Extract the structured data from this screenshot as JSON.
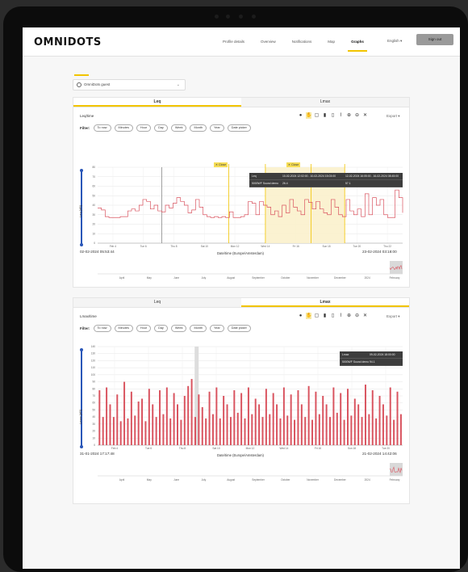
{
  "app": {
    "logo": "OMNIDOTS",
    "nav": [
      "Profile details",
      "Overview",
      "Notifications",
      "Map",
      "Graphs"
    ],
    "language": "English ▾",
    "sign_out": "Sign out"
  },
  "device_select": {
    "value": "OmniDots guest",
    "chevron": "⌄"
  },
  "panels": [
    {
      "tabs": [
        "Leq",
        "Lmax"
      ],
      "chart_title": "Leq/time",
      "filter_label": "Filter:",
      "filters": [
        "To now",
        "Minutes",
        "Hour",
        "Day",
        "Week",
        "Month",
        "Year",
        "Date picker"
      ],
      "export": "Export ▾",
      "y_label": "Leq [dB]",
      "x_label": "Date/time (Europe/Amsterdam)",
      "date_start": "02-02-2024 05:53:44",
      "date_end": "23-02-2024 03:18:00",
      "x_ticks": [
        "Feb 4",
        "Tue 6",
        "Thu 8",
        "Sat 10",
        "Mon 12",
        "Wed 14",
        "Fri 16",
        "Sun 18",
        "Tue 20",
        "Thu 22"
      ],
      "nav_ticks": [
        "April",
        "May",
        "June",
        "July",
        "August",
        "September",
        "October",
        "November",
        "December",
        "2024",
        "February"
      ],
      "close_label": "✕ Close",
      "legend": {
        "headers": [
          "Leq",
          "10-02-2024 12:02:00 - 10-02-2024 15:03:00",
          "12-02-2024 16:05:00 - 16-02-2024 08:45:00"
        ],
        "row": [
          "5000WF Sound demo",
          "26.4",
          "57.1"
        ]
      }
    },
    {
      "tabs": [
        "Leq",
        "Lmax"
      ],
      "chart_title": "Lmax/time",
      "filter_label": "Filter:",
      "filters": [
        "To now",
        "Minutes",
        "Hour",
        "Day",
        "Week",
        "Month",
        "Year",
        "Date picker"
      ],
      "export": "Export ▾",
      "y_label": "Lmax [dB]",
      "x_label": "Date/time (Europe/Amsterdam)",
      "date_start": "31-01-2024 17:17:48",
      "date_end": "21-02-2024 14:42:06",
      "x_ticks": [
        "Feb 4",
        "Tue 6",
        "Thu 8",
        "Sat 10",
        "Mon 12",
        "Wed 14",
        "Fri 16",
        "Sun 18",
        "Tue 20"
      ],
      "nav_ticks": [
        "April",
        "May",
        "June",
        "July",
        "August",
        "September",
        "October",
        "November",
        "December",
        "2024",
        "February"
      ],
      "legend": {
        "headers": [
          "Lmax",
          "09-02-2024 18:00:00"
        ],
        "row": [
          "5000WF Sound demo",
          "94.1"
        ]
      }
    }
  ],
  "chart_data": [
    {
      "type": "line",
      "title": "Leq/time",
      "ylabel": "Leq [dB]",
      "xlabel": "Date/time (Europe/Amsterdam)",
      "ylim": [
        0,
        80
      ],
      "y_ticks": [
        0,
        10,
        20,
        30,
        40,
        50,
        60,
        70,
        80
      ],
      "color": "#d9535f",
      "values": [
        37,
        35,
        28,
        27,
        27,
        27,
        28,
        28,
        34,
        36,
        34,
        40,
        46,
        44,
        36,
        40,
        34,
        33,
        40,
        37,
        42,
        48,
        44,
        40,
        32,
        35,
        46,
        38,
        30,
        28,
        27,
        28,
        27,
        28,
        27,
        33,
        27,
        27,
        28,
        30,
        44,
        42,
        30,
        44,
        40,
        38,
        30,
        34,
        28,
        40,
        32,
        46,
        38,
        34,
        30,
        46,
        43,
        36,
        44,
        36,
        32,
        30,
        46,
        38,
        30,
        28,
        46,
        34,
        30,
        36,
        28,
        52,
        30,
        48,
        40,
        46,
        30,
        27,
        27,
        56,
        48,
        32
      ]
    },
    {
      "type": "bar",
      "title": "Lmax/time",
      "ylabel": "Lmax [dB]",
      "xlabel": "Date/time (Europe/Amsterdam)",
      "ylim": [
        0,
        140
      ],
      "y_ticks": [
        0,
        10,
        20,
        30,
        40,
        50,
        60,
        70,
        80,
        90,
        100,
        110,
        120,
        130,
        140
      ],
      "color": "#d9535f",
      "values": [
        78,
        40,
        82,
        58,
        40,
        72,
        34,
        90,
        38,
        76,
        42,
        62,
        66,
        34,
        80,
        58,
        40,
        78,
        44,
        82,
        38,
        74,
        58,
        36,
        70,
        84,
        94,
        40,
        72,
        54,
        38,
        76,
        44,
        82,
        38,
        70,
        58,
        40,
        78,
        46,
        74,
        38,
        82,
        44,
        66,
        58,
        40,
        80,
        44,
        74,
        58,
        38,
        82,
        42,
        72,
        36,
        78,
        58,
        40,
        84,
        36,
        76,
        44,
        70,
        58,
        40,
        82,
        46,
        74,
        36,
        80,
        42,
        66,
        58,
        40,
        86,
        44,
        78,
        38,
        70,
        58,
        42,
        82,
        36,
        76,
        44
      ]
    }
  ]
}
